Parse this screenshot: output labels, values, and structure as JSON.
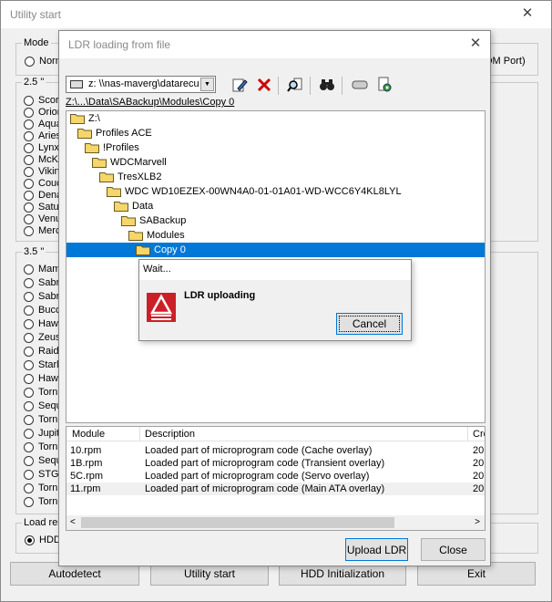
{
  "main": {
    "title": "Utility start",
    "mode_label": "Mode",
    "mode_option": "Norm",
    "port_text": "OM Port)",
    "group25_label": "2.5 \"",
    "group25_items": [
      "Scor",
      "Orior",
      "Aqua",
      "Aries",
      "Lynx",
      "McK",
      "Vikin",
      "Couc",
      "Dena",
      "Satu",
      "Venu",
      "Merc"
    ],
    "group35_label": "3.5 \"",
    "group35_items": [
      "Mam",
      "Sabr",
      "Sabr",
      "Bucc",
      "Haw",
      "Zeus",
      "Raid",
      "Starl",
      "Haw",
      "Torn",
      "Sequ",
      "Torn",
      "Jupit",
      "Torn",
      "Sequ",
      "STG T",
      "Torn",
      "Torn"
    ],
    "load_label": "Load res",
    "load_option": "HDD",
    "buttons": {
      "autodetect": "Autodetect",
      "utility_start": "Utility start",
      "hdd_init": "HDD Initialization",
      "exit": "Exit"
    }
  },
  "ldr": {
    "title": "LDR loading from file",
    "drive": "z: \\\\nas-maverg\\datarecu",
    "path": "Z:\\...\\Data\\SABackup\\Modules\\Copy 0",
    "tree": [
      {
        "label": "Z:\\",
        "depth": 0
      },
      {
        "label": "Profiles ACE",
        "depth": 1
      },
      {
        "label": "!Profiles",
        "depth": 2
      },
      {
        "label": "WDCMarvell",
        "depth": 3
      },
      {
        "label": "TresXLB2",
        "depth": 4
      },
      {
        "label": "WDC WD10EZEX-00WN4A0-01-01A01-WD-WCC6Y4KL8LYL",
        "depth": 5
      },
      {
        "label": "Data",
        "depth": 6
      },
      {
        "label": "SABackup",
        "depth": 7
      },
      {
        "label": "Modules",
        "depth": 8
      },
      {
        "label": "Copy 0",
        "depth": 9
      }
    ],
    "columns": {
      "module": "Module",
      "description": "Description",
      "created": "Cre"
    },
    "rows": [
      {
        "module": "10.rpm",
        "description": "Loaded part of microprogram code (Cache overlay)",
        "created": "20"
      },
      {
        "module": "1B.rpm",
        "description": "Loaded part of microprogram code (Transient overlay)",
        "created": "20"
      },
      {
        "module": "5C.rpm",
        "description": "Loaded part of microprogram code (Servo overlay)",
        "created": "20"
      },
      {
        "module": "11.rpm",
        "description": "Loaded part of microprogram code (Main ATA overlay)",
        "created": "20"
      }
    ],
    "buttons": {
      "upload": "Upload LDR",
      "close": "Close"
    }
  },
  "wait": {
    "title": "Wait...",
    "message": "LDR uploading",
    "cancel": "Cancel"
  },
  "colors": {
    "selection": "#0078d7",
    "folder": "#f5d66b",
    "delete": "#d00000",
    "logo": "#cc2027"
  }
}
